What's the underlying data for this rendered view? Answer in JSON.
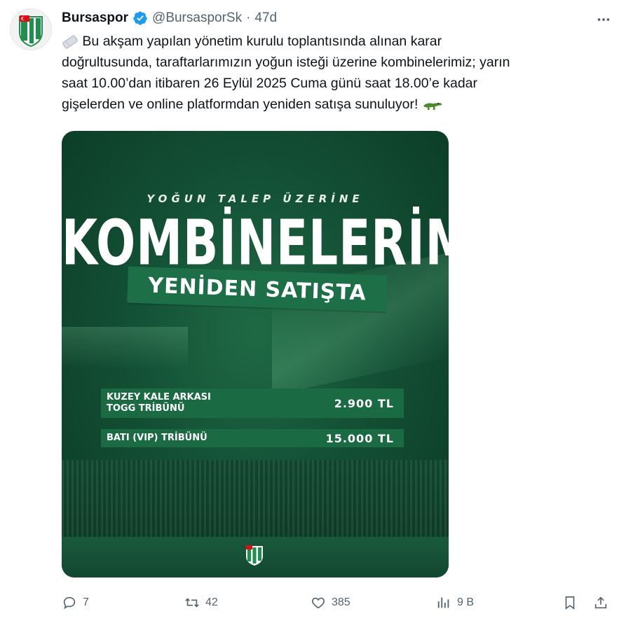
{
  "tweet": {
    "display_name": "Bursaspor",
    "handle": "@BursasporSk",
    "separator": "·",
    "time": "47d",
    "text_line1": "Bu akşam yapılan yönetim kurulu toplantısında alınan karar",
    "text_line2": "doğrultusunda, taraftarlarımızın yoğun isteği üzerine kombinelerimiz; yarın",
    "text_line3": "saat 10.00’dan itibaren 26 Eylül 2025 Cuma günü saat 18.00’e kadar",
    "text_line4": "gişelerden ve online platformdan yeniden satışa sunuluyor!",
    "leading_emoji": "ticket-icon",
    "trailing_emoji": "crocodile-icon"
  },
  "media": {
    "kicker": "YOĞUN TALEP ÜZERİNE",
    "headline": "KOMBİNELERİMİZ",
    "ribbon": "YENİDEN SATIŞTA",
    "prices": [
      {
        "label": "KUZEY KALE ARKASI\nTOGG TRİBÜNÜ",
        "price": "2.900 TL"
      },
      {
        "label": "BATI (VIP) TRİBÜNÜ",
        "price": "15.000 TL"
      }
    ],
    "crest": "bursaspor-crest"
  },
  "actions": {
    "replies": "7",
    "retweets": "42",
    "likes": "385",
    "views": "9 B"
  },
  "colors": {
    "brand_green": "#1d6f47",
    "verified_blue": "#1d9bf0",
    "muted": "#536471"
  }
}
